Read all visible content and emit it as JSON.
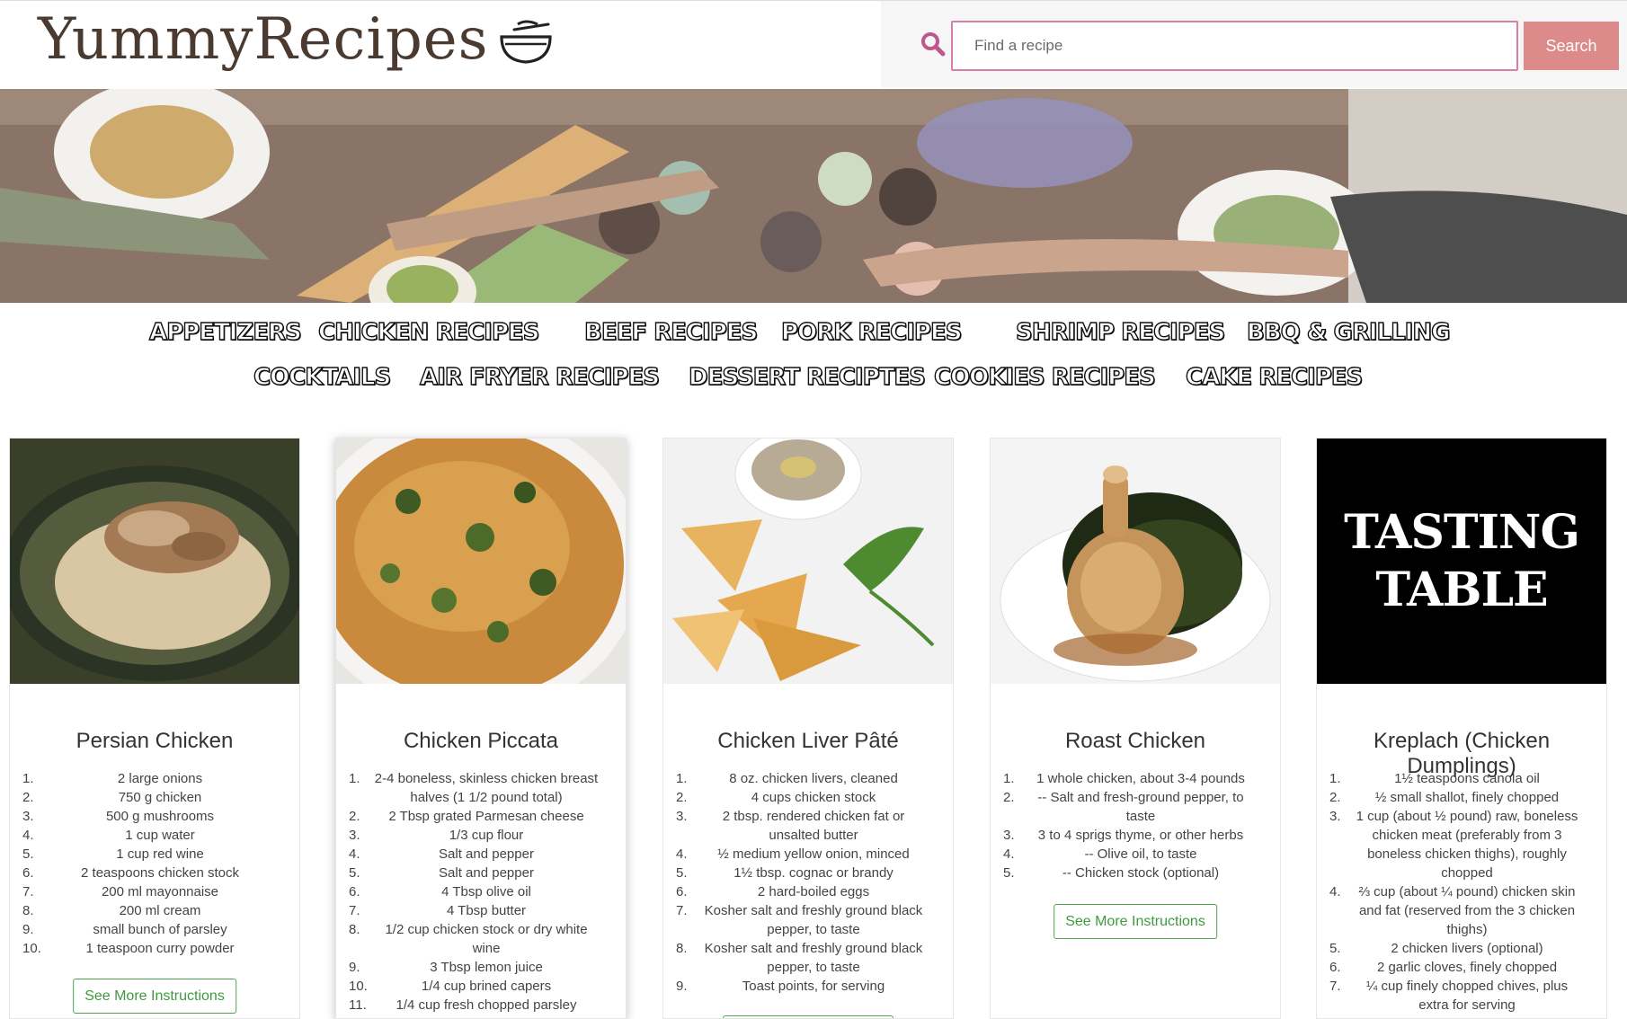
{
  "header": {
    "logo_text": "YummyRecipes",
    "search": {
      "placeholder": "Find a recipe",
      "button_label": "Search"
    }
  },
  "categories": {
    "row1": [
      "APPETIZERS",
      "CHICKEN RECIPES",
      "BEEF RECIPES",
      "PORK RECIPES",
      "SHRIMP RECIPES",
      "BBQ & GRILLING"
    ],
    "row2": [
      "COCKTAILS",
      "AIR FRYER RECIPES",
      "DESSERT RECIPTES",
      "COOKIES RECIPES",
      "CAKE RECIPES"
    ]
  },
  "cards": [
    {
      "title": "Persian Chicken",
      "ingredients": [
        "2 large onions",
        "750 g chicken",
        "500 g mushrooms",
        "1 cup water",
        "1 cup red wine",
        "2 teaspoons chicken stock",
        "200 ml mayonnaise",
        "200 ml cream",
        "small bunch of parsley",
        "1 teaspoon curry powder"
      ],
      "button": "See More Instructions"
    },
    {
      "title": "Chicken Piccata",
      "ingredients": [
        "2-4 boneless, skinless chicken breast halves (1 1/2 pound total)",
        "2 Tbsp grated Parmesan cheese",
        "1/3 cup flour",
        "Salt and pepper",
        "Salt and pepper",
        "4 Tbsp olive oil",
        "4 Tbsp butter",
        "1/2 cup chicken stock or dry white wine",
        "3 Tbsp lemon juice",
        "1/4 cup brined capers",
        "1/4 cup fresh chopped parsley"
      ]
    },
    {
      "title": "Chicken Liver Pâté",
      "ingredients": [
        "8 oz. chicken livers, cleaned",
        "4 cups chicken stock",
        "2 tbsp. rendered chicken fat or unsalted butter",
        "½ medium yellow onion, minced",
        "1½ tbsp. cognac or brandy",
        "2 hard-boiled eggs",
        "Kosher salt and freshly ground black pepper, to taste",
        "Kosher salt and freshly ground black pepper, to taste",
        "Toast points, for serving"
      ]
    },
    {
      "title": "Roast Chicken",
      "ingredients": [
        "1 whole chicken, about 3-4 pounds",
        "-- Salt and fresh-ground pepper, to taste",
        "3 to 4 sprigs thyme, or other herbs",
        "-- Olive oil, to taste",
        "-- Chicken stock (optional)"
      ],
      "button": "See More Instructions"
    },
    {
      "title": "Kreplach (Chicken Dumplings)",
      "logo_line1": "TASTING",
      "logo_line2": "TABLE",
      "ingredients": [
        "1½ teaspoons canola oil",
        "½ small shallot, finely chopped",
        "1 cup (about ½ pound) raw, boneless chicken meat (preferably from 3 boneless chicken thighs), roughly chopped",
        "⅔ cup (about ¼ pound) chicken skin and fat (reserved from the 3 chicken thighs)",
        "2 chicken livers (optional)",
        "2 garlic cloves, finely chopped",
        "¼ cup finely chopped chives, plus extra for serving"
      ]
    }
  ],
  "colors": {
    "accent_pink": "#d77ea9",
    "search_button": "#dd8a8a",
    "green_button": "#4ca64c"
  }
}
